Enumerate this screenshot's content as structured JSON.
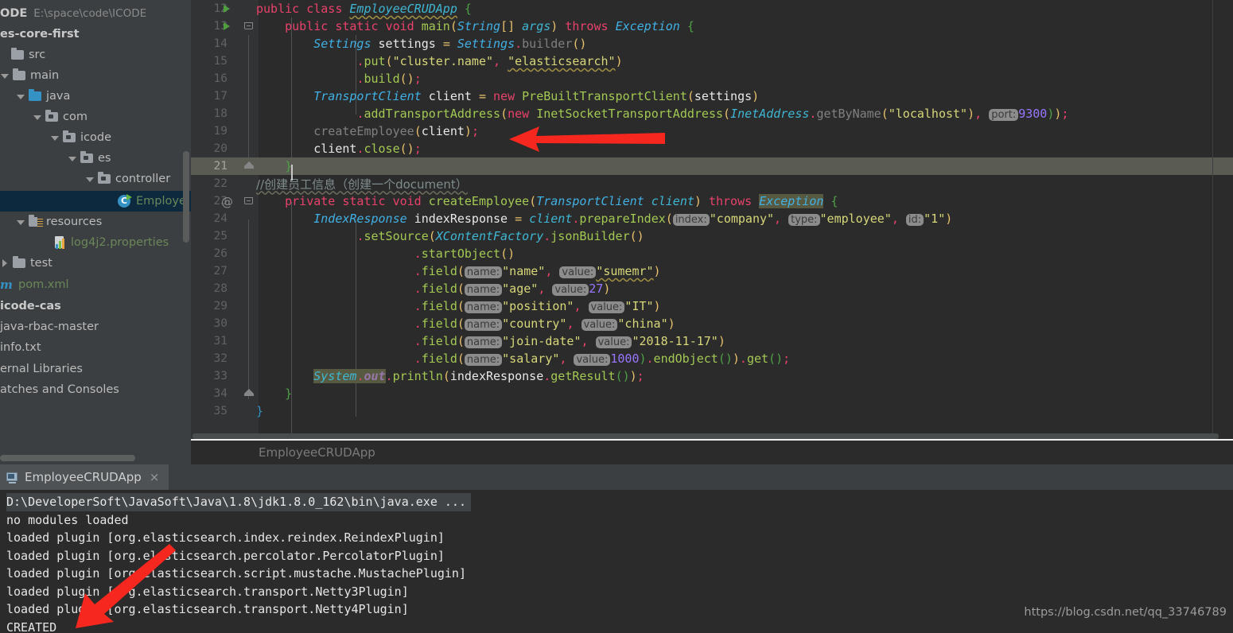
{
  "sidebar": {
    "project_header": {
      "name": "ODE",
      "path": "E:\\space\\code\\ICODE"
    },
    "items": [
      {
        "label": "es-core-first",
        "style": "bold",
        "icon": "none",
        "arrow": "none",
        "indent": 0
      },
      {
        "label": "src",
        "style": "plain",
        "icon": "folder",
        "arrow": "none",
        "indent": 0
      },
      {
        "label": "main",
        "style": "plain",
        "icon": "folder",
        "arrow": "down",
        "indent": 1
      },
      {
        "label": "java",
        "style": "plain",
        "icon": "folder-blue",
        "arrow": "down",
        "indent": 2
      },
      {
        "label": "com",
        "style": "plain",
        "icon": "package",
        "arrow": "down",
        "indent": 3
      },
      {
        "label": "icode",
        "style": "plain",
        "icon": "package",
        "arrow": "down",
        "indent": 4
      },
      {
        "label": "es",
        "style": "plain",
        "icon": "package",
        "arrow": "down",
        "indent": 5
      },
      {
        "label": "controller",
        "style": "plain",
        "icon": "package",
        "arrow": "down",
        "indent": 6
      },
      {
        "label": "Employe",
        "style": "green",
        "icon": "java-class",
        "arrow": "none",
        "indent": 7,
        "selected": true
      },
      {
        "label": "resources",
        "style": "plain",
        "icon": "folder-res",
        "arrow": "down",
        "indent": 1
      },
      {
        "label": "log4j2.properties",
        "style": "green",
        "icon": "properties",
        "arrow": "none",
        "indent": 2
      },
      {
        "label": "test",
        "style": "plain",
        "icon": "folder",
        "arrow": "right",
        "indent": 0
      },
      {
        "label": "pom.xml",
        "style": "green",
        "icon": "maven",
        "arrow": "none",
        "indent": 0
      },
      {
        "label": "icode-cas",
        "style": "bold",
        "icon": "none",
        "arrow": "none",
        "indent": 0
      },
      {
        "label": "java-rbac-master",
        "style": "plain",
        "icon": "none",
        "arrow": "none",
        "indent": 0
      },
      {
        "label": "info.txt",
        "style": "plain",
        "icon": "none",
        "arrow": "none",
        "indent": 0
      },
      {
        "label": "ernal Libraries",
        "style": "plain",
        "icon": "none",
        "arrow": "none",
        "indent": 0
      },
      {
        "label": "atches and Consoles",
        "style": "plain",
        "icon": "none",
        "arrow": "none",
        "indent": 0
      }
    ]
  },
  "editor": {
    "breadcrumb": "EmployeeCRUDApp",
    "current_line": 21,
    "lines": [
      {
        "n": 12,
        "gutter": "run",
        "fold": "none"
      },
      {
        "n": 13,
        "gutter": "run",
        "fold": "open"
      },
      {
        "n": 14,
        "gutter": "none",
        "fold": "none"
      },
      {
        "n": 15,
        "gutter": "none",
        "fold": "none"
      },
      {
        "n": 16,
        "gutter": "none",
        "fold": "none"
      },
      {
        "n": 17,
        "gutter": "none",
        "fold": "none"
      },
      {
        "n": 18,
        "gutter": "none",
        "fold": "none"
      },
      {
        "n": 19,
        "gutter": "none",
        "fold": "none"
      },
      {
        "n": 20,
        "gutter": "none",
        "fold": "none"
      },
      {
        "n": 21,
        "gutter": "none",
        "fold": "end"
      },
      {
        "n": 22,
        "gutter": "none",
        "fold": "none"
      },
      {
        "n": 23,
        "gutter": "at",
        "fold": "open"
      },
      {
        "n": 24,
        "gutter": "none",
        "fold": "none"
      },
      {
        "n": 25,
        "gutter": "none",
        "fold": "none"
      },
      {
        "n": 26,
        "gutter": "none",
        "fold": "none"
      },
      {
        "n": 27,
        "gutter": "none",
        "fold": "none"
      },
      {
        "n": 28,
        "gutter": "none",
        "fold": "none"
      },
      {
        "n": 29,
        "gutter": "none",
        "fold": "none"
      },
      {
        "n": 30,
        "gutter": "none",
        "fold": "none"
      },
      {
        "n": 31,
        "gutter": "none",
        "fold": "none"
      },
      {
        "n": 32,
        "gutter": "none",
        "fold": "none"
      },
      {
        "n": 33,
        "gutter": "none",
        "fold": "none"
      },
      {
        "n": 34,
        "gutter": "none",
        "fold": "end"
      },
      {
        "n": 35,
        "gutter": "none",
        "fold": "none"
      }
    ],
    "source_plain": [
      "public class EmployeeCRUDApp {",
      "    public static void main(String[] args) throws Exception {",
      "        Settings settings = Settings.builder()",
      "                .put(\"cluster.name\", \"elasticsearch\")",
      "                .build();",
      "        TransportClient client = new PreBuiltTransportClient(settings)",
      "                .addTransportAddress(new InetSocketTransportAddress(InetAddress.getByName(\"localhost\"), port: 9300));",
      "        createEmployee(client);",
      "        client.close();",
      "    }",
      "    //创建员工信息（创建一个document）",
      "    private static void createEmployee(TransportClient client) throws Exception {",
      "        IndexResponse indexResponse = client.prepareIndex( index: \"company\",  type: \"employee\",  id: \"1\")",
      "                .setSource(XContentFactory.jsonBuilder()",
      "                        .startObject()",
      "                        .field( name: \"name\",  value: \"sumemr\")",
      "                        .field( name: \"age\",  value: 27)",
      "                        .field( name: \"position\",  value: \"IT\")",
      "                        .field( name: \"country\",  value: \"china\")",
      "                        .field( name: \"join-date\",  value: \"2018-11-17\")",
      "                        .field( name: \"salary\",  value: 1000).endObject()).get();",
      "        System.out.println(indexResponse.getResult());",
      "    }",
      "}"
    ],
    "param_hints": [
      "port:",
      "index:",
      "type:",
      "id:",
      "name:",
      "value:"
    ],
    "comment_line": "//创建员工信息（创建一个document）"
  },
  "run_panel": {
    "tab_label": "EmployeeCRUDApp",
    "tab_close": "×",
    "console_lines": [
      "D:\\DeveloperSoft\\JavaSoft\\Java\\1.8\\jdk1.8.0_162\\bin\\java.exe ...",
      "no modules loaded",
      "loaded plugin [org.elasticsearch.index.reindex.ReindexPlugin]",
      "loaded plugin [org.elasticsearch.percolator.PercolatorPlugin]",
      "loaded plugin [org.elasticsearch.script.mustache.MustachePlugin]",
      "loaded plugin [org.elasticsearch.transport.Netty3Plugin]",
      "loaded plugin [org.elasticsearch.transport.Netty4Plugin]",
      "CREATED"
    ]
  },
  "watermark": "https://blog.csdn.net/qq_33746789",
  "colors": {
    "editor_bg": "#2b2b2b",
    "sidebar_bg": "#3c3f41",
    "selection_bg": "#0d293e",
    "current_line_bg": "#5a5b52",
    "annotation_arrow": "#f5271f"
  }
}
